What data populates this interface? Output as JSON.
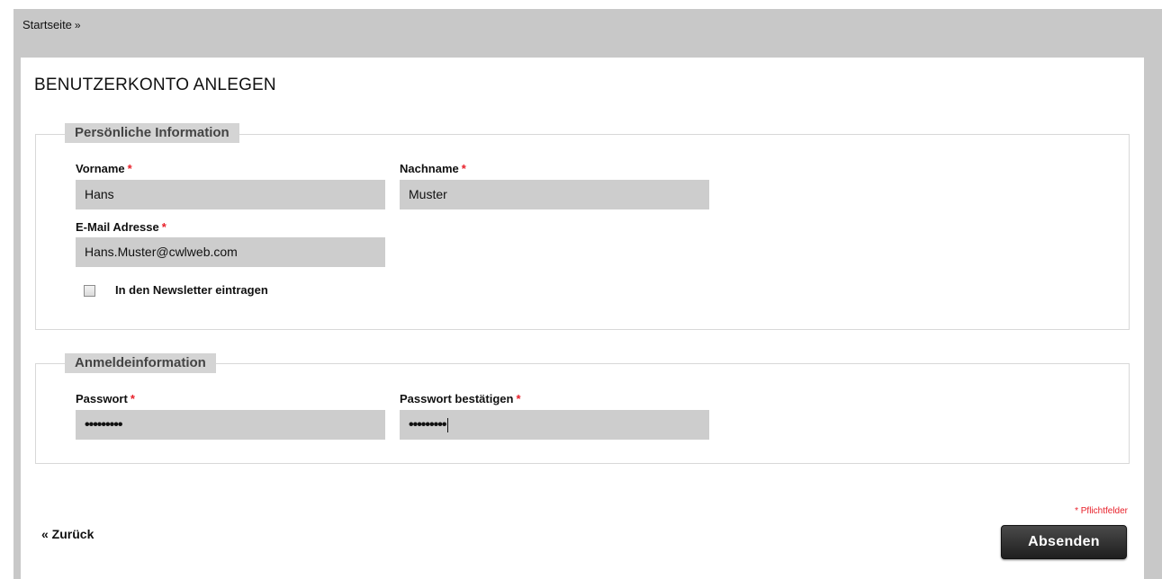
{
  "breadcrumb": {
    "home_label": "Startseite",
    "separator": "»"
  },
  "page": {
    "title": "BENUTZERKONTO ANLEGEN"
  },
  "personal_info": {
    "legend": "Persönliche Information",
    "first_name": {
      "label": "Vorname",
      "required_mark": "*",
      "value": "Hans"
    },
    "last_name": {
      "label": "Nachname",
      "required_mark": "*",
      "value": "Muster"
    },
    "email": {
      "label": "E-Mail Adresse",
      "required_mark": "*",
      "value": "Hans.Muster@cwlweb.com"
    },
    "newsletter": {
      "label": "In den Newsletter eintragen",
      "checked": false
    }
  },
  "login_info": {
    "legend": "Anmeldeinformation",
    "password": {
      "label": "Passwort",
      "required_mark": "*",
      "masked_value": "•••••••••"
    },
    "confirm_password": {
      "label": "Passwort bestätigen",
      "required_mark": "*",
      "masked_value": "•••••••••"
    }
  },
  "footer": {
    "required_note": "* Pflichtfelder",
    "back_label": "« Zurück",
    "submit_label": "Absenden"
  },
  "colors": {
    "required_red": "#e8202a",
    "input_bg": "#cdcdcd",
    "page_bg": "#c8c8c8",
    "legend_bg": "#d4d4d4",
    "button_dark": "#1e1e1e"
  }
}
